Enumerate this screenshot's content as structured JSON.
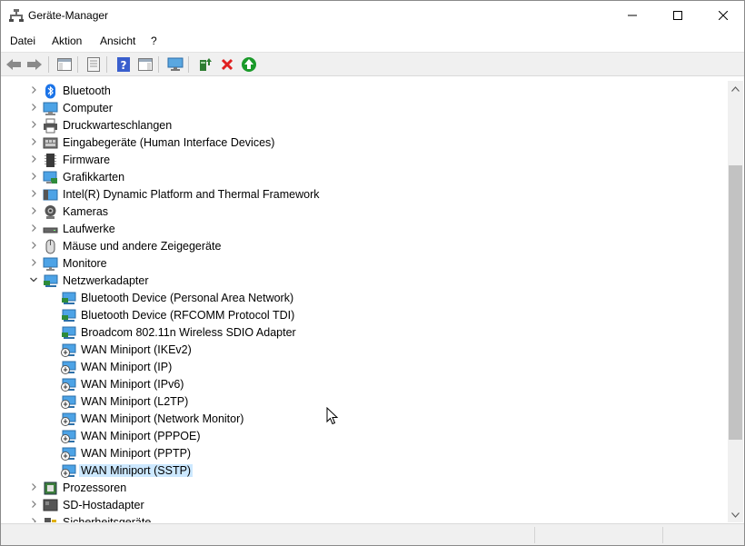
{
  "window": {
    "title": "Geräte-Manager",
    "controls": [
      "minimize",
      "maximize",
      "close"
    ]
  },
  "menu": [
    {
      "label": "Datei"
    },
    {
      "label": "Aktion"
    },
    {
      "label": "Ansicht"
    },
    {
      "label": "?"
    }
  ],
  "toolbar": {
    "buttons": [
      "back-icon",
      "forward-icon",
      "show-hide-console-tree-icon",
      "properties-icon",
      "help-icon",
      "action-pane-icon",
      "scan-hardware-icon",
      "update-driver-icon",
      "uninstall-device-icon",
      "enable-device-icon"
    ]
  },
  "tree": {
    "categories": [
      {
        "label": "Bluetooth",
        "icon": "bluetooth-icon",
        "expanded": false
      },
      {
        "label": "Computer",
        "icon": "computer-icon",
        "expanded": false
      },
      {
        "label": "Druckwarteschlangen",
        "icon": "printer-icon",
        "expanded": false
      },
      {
        "label": "Eingabegeräte (Human Interface Devices)",
        "icon": "hid-icon",
        "expanded": false
      },
      {
        "label": "Firmware",
        "icon": "firmware-icon",
        "expanded": false
      },
      {
        "label": "Grafikkarten",
        "icon": "display-adapter-icon",
        "expanded": false
      },
      {
        "label": "Intel(R) Dynamic Platform and Thermal Framework",
        "icon": "thermal-framework-icon",
        "expanded": false
      },
      {
        "label": "Kameras",
        "icon": "camera-icon",
        "expanded": false
      },
      {
        "label": "Laufwerke",
        "icon": "disk-drive-icon",
        "expanded": false
      },
      {
        "label": "Mäuse und andere Zeigegeräte",
        "icon": "mouse-icon",
        "expanded": false
      },
      {
        "label": "Monitore",
        "icon": "monitor-icon",
        "expanded": false
      },
      {
        "label": "Netzwerkadapter",
        "icon": "network-adapter-icon",
        "expanded": true,
        "children": [
          {
            "label": "Bluetooth Device (Personal Area Network)",
            "icon": "network-adapter-icon"
          },
          {
            "label": "Bluetooth Device (RFCOMM Protocol TDI)",
            "icon": "network-adapter-icon"
          },
          {
            "label": "Broadcom 802.11n Wireless SDIO Adapter",
            "icon": "network-adapter-icon"
          },
          {
            "label": "WAN Miniport (IKEv2)",
            "icon": "wan-miniport-icon"
          },
          {
            "label": "WAN Miniport (IP)",
            "icon": "wan-miniport-icon"
          },
          {
            "label": "WAN Miniport (IPv6)",
            "icon": "wan-miniport-icon"
          },
          {
            "label": "WAN Miniport (L2TP)",
            "icon": "wan-miniport-icon"
          },
          {
            "label": "WAN Miniport (Network Monitor)",
            "icon": "wan-miniport-icon"
          },
          {
            "label": "WAN Miniport (PPPOE)",
            "icon": "wan-miniport-icon"
          },
          {
            "label": "WAN Miniport (PPTP)",
            "icon": "wan-miniport-icon"
          },
          {
            "label": "WAN Miniport (SSTP)",
            "icon": "wan-miniport-icon",
            "selected": true
          }
        ]
      },
      {
        "label": "Prozessoren",
        "icon": "processor-icon",
        "expanded": false
      },
      {
        "label": "SD-Hostadapter",
        "icon": "sd-host-icon",
        "expanded": false
      },
      {
        "label": "Sicherheitsgeräte",
        "icon": "security-device-icon",
        "expanded": false
      }
    ]
  },
  "colors": {
    "selection": "#cce8ff",
    "toolbar_bg": "#f0f0f0",
    "scroll_thumb": "#c2c2c2"
  }
}
